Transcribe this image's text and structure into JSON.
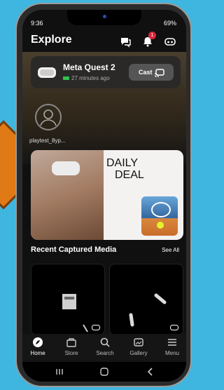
{
  "status": {
    "time": "9:36",
    "right": "69%"
  },
  "header": {
    "title": "Explore",
    "notification_count": "1"
  },
  "device": {
    "name": "Meta Quest 2",
    "last_seen": "27 minutes ago",
    "cast_label": "Cast"
  },
  "profile": {
    "username": "playtest_8yp..."
  },
  "deal": {
    "line1": "DAILY",
    "line2": "DEAL"
  },
  "media": {
    "title": "Recent Captured Media",
    "see_all": "See All"
  },
  "nav": [
    {
      "label": "Home"
    },
    {
      "label": "Store"
    },
    {
      "label": "Search"
    },
    {
      "label": "Gallery"
    },
    {
      "label": "Menu"
    }
  ],
  "colors": {
    "accent_badge": "#d8253a",
    "battery": "#32c24d",
    "highlight_arrow": "#e07a17",
    "background": "#3fb6df"
  }
}
